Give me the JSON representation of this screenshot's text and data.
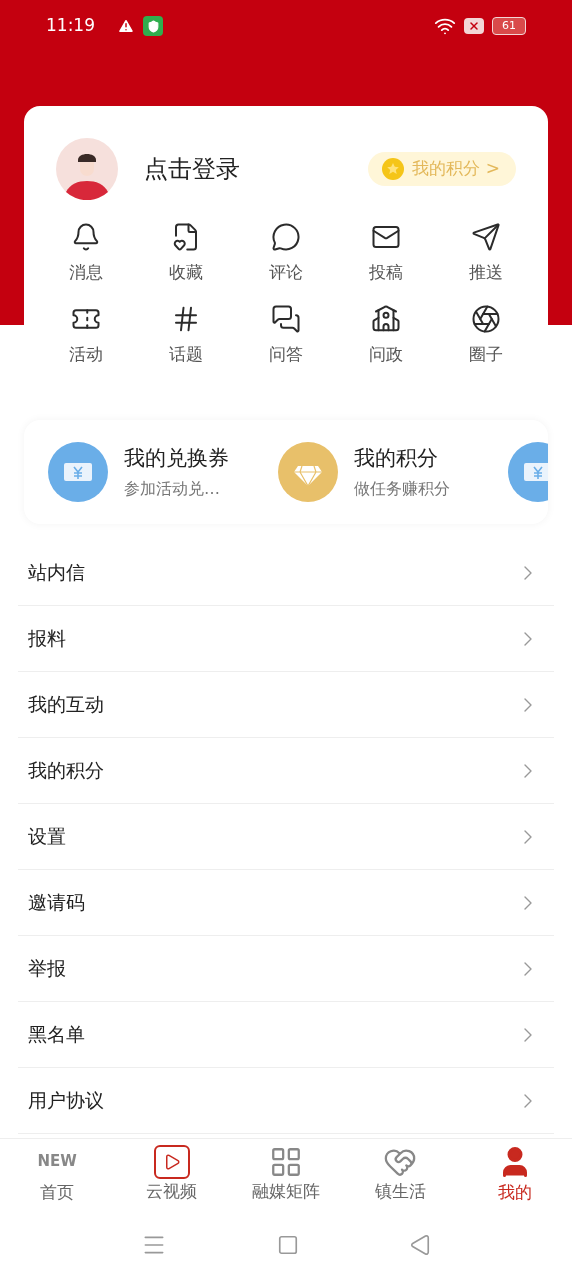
{
  "status_bar": {
    "time": "11:19",
    "battery": "61"
  },
  "profile": {
    "login_label": "点击登录",
    "points_label": "我的积分 >"
  },
  "shortcuts": [
    {
      "label": "消息",
      "kind": "bell"
    },
    {
      "label": "收藏",
      "kind": "favorite"
    },
    {
      "label": "评论",
      "kind": "comment"
    },
    {
      "label": "投稿",
      "kind": "mail"
    },
    {
      "label": "推送",
      "kind": "send"
    },
    {
      "label": "活动",
      "kind": "ticket"
    },
    {
      "label": "话题",
      "kind": "topic"
    },
    {
      "label": "问答",
      "kind": "qa"
    },
    {
      "label": "问政",
      "kind": "building"
    },
    {
      "label": "圈子",
      "kind": "aperture"
    }
  ],
  "wallet_cards": [
    {
      "title": "我的兑换券",
      "subtitle": "参加活动兑…",
      "kind": "coupon"
    },
    {
      "title": "我的积分",
      "subtitle": "做任务赚积分",
      "kind": "diamond"
    },
    {
      "kind": "coupon"
    }
  ],
  "menu": [
    "站内信",
    "报料",
    "我的互动",
    "我的积分",
    "设置",
    "邀请码",
    "举报",
    "黑名单",
    "用户协议"
  ],
  "bottom_nav": [
    {
      "label": "首页",
      "kind": "home",
      "icon_text": "NEW",
      "selected": false
    },
    {
      "label": "云视频",
      "kind": "video",
      "selected": false
    },
    {
      "label": "融媒矩阵",
      "kind": "grid",
      "selected": false
    },
    {
      "label": "镇生活",
      "kind": "heart",
      "selected": false
    },
    {
      "label": "我的",
      "kind": "user",
      "selected": true
    }
  ]
}
